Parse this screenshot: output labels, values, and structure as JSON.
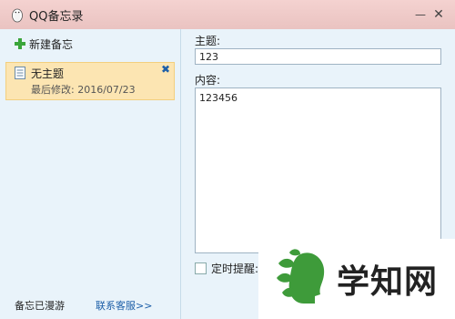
{
  "window": {
    "title": "QQ备忘录",
    "minimize_label": "—",
    "close_label": "✕"
  },
  "sidebar": {
    "new_note_label": "新建备忘",
    "notes": [
      {
        "title": "无主题",
        "modified": "最后修改: 2016/07/23",
        "close": "✖"
      }
    ],
    "roaming_status": "备忘已漫游",
    "support_link": "联系客服>>"
  },
  "editor": {
    "subject_label": "主题:",
    "subject_value": "123",
    "content_label": "内容:",
    "content_value": "123456",
    "reminder_label": "定时提醒:"
  },
  "watermark": {
    "text": "学知网"
  },
  "icons": {
    "logo": "qq-penguin-icon",
    "new_note": "plus-icon",
    "note": "note-icon",
    "close": "close-icon",
    "minimize": "minimize-icon"
  },
  "colors": {
    "titlebar": "#eac3c1",
    "panel": "#e9f3fa",
    "selected_note": "#fce5b2",
    "link": "#1d5fa8",
    "plus": "#3aa53a",
    "watermark_green": "#3e9b3a"
  }
}
